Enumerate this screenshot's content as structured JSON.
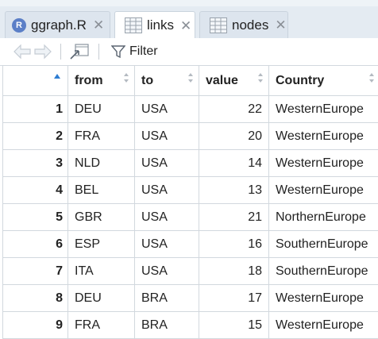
{
  "tabs": [
    {
      "label": "ggraph.R",
      "icon": "r-file-icon",
      "active": false
    },
    {
      "label": "links",
      "icon": "table-icon",
      "active": true
    },
    {
      "label": "nodes",
      "icon": "table-icon",
      "active": false
    }
  ],
  "tab_close_glyph": "✕",
  "r_logo_text": "R",
  "toolbar": {
    "filter_label": "Filter"
  },
  "columns": [
    "from",
    "to",
    "value",
    "Country"
  ],
  "rows": [
    {
      "idx": "1",
      "from": "DEU",
      "to": "USA",
      "value": "22",
      "country": "WesternEurope"
    },
    {
      "idx": "2",
      "from": "FRA",
      "to": "USA",
      "value": "20",
      "country": "WesternEurope"
    },
    {
      "idx": "3",
      "from": "NLD",
      "to": "USA",
      "value": "14",
      "country": "WesternEurope"
    },
    {
      "idx": "4",
      "from": "BEL",
      "to": "USA",
      "value": "13",
      "country": "WesternEurope"
    },
    {
      "idx": "5",
      "from": "GBR",
      "to": "USA",
      "value": "21",
      "country": "NorthernEurope"
    },
    {
      "idx": "6",
      "from": "ESP",
      "to": "USA",
      "value": "16",
      "country": "SouthernEurope"
    },
    {
      "idx": "7",
      "from": "ITA",
      "to": "USA",
      "value": "18",
      "country": "SouthernEurope"
    },
    {
      "idx": "8",
      "from": "DEU",
      "to": "BRA",
      "value": "17",
      "country": "WesternEurope"
    },
    {
      "idx": "9",
      "from": "FRA",
      "to": "BRA",
      "value": "15",
      "country": "WesternEurope"
    }
  ],
  "colors": {
    "accent": "#2d7dd2",
    "tabbar": "#e4ebf2",
    "border": "#d2d8de"
  }
}
